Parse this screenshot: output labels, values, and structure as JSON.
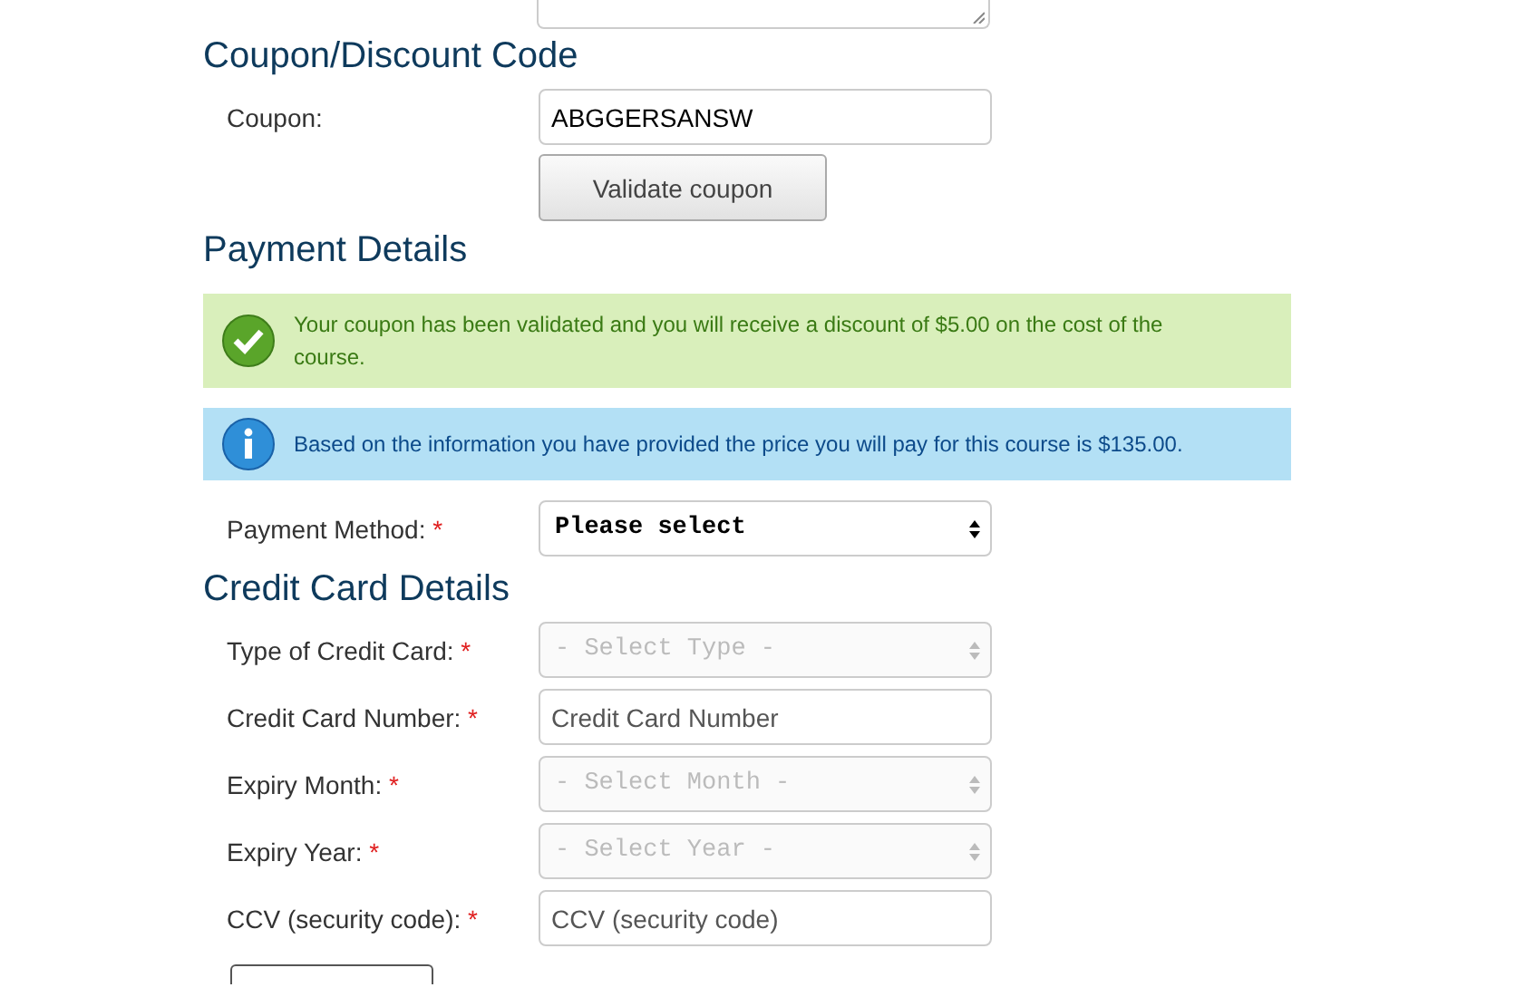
{
  "sections": [
    {
      "heading": "Coupon/Discount Code",
      "fields": [
        {
          "label": "Coupon:",
          "kind": "text",
          "value": "ABGGERSANSW"
        }
      ],
      "button": "Validate coupon"
    },
    {
      "heading": "Payment Details",
      "alerts": [
        {
          "kind": "success",
          "text": "Your coupon has been validated and you will receive a discount of $5.00 on the cost of the course."
        },
        {
          "kind": "info",
          "text": "Based on the information you have provided the price you will pay for this course is $135.00."
        }
      ],
      "fields": [
        {
          "label": "Payment Method:",
          "required_mark": "*",
          "kind": "select",
          "value": "Please select",
          "disabled": false
        }
      ]
    },
    {
      "heading": "Credit Card Details",
      "fields": [
        {
          "label": "Type of Credit Card:",
          "required_mark": "*",
          "kind": "select",
          "value": "- Select Type -",
          "disabled": true
        },
        {
          "label": "Credit Card Number:",
          "required_mark": "*",
          "kind": "text",
          "placeholder": "Credit Card Number"
        },
        {
          "label": "Expiry Month:",
          "required_mark": "*",
          "kind": "select",
          "value": "- Select Month -",
          "disabled": true
        },
        {
          "label": "Expiry Year:",
          "required_mark": "*",
          "kind": "select",
          "value": "- Select Year -",
          "disabled": true
        },
        {
          "label": "CCV (security code):",
          "required_mark": "*",
          "kind": "text",
          "placeholder": "CCV (security code)"
        }
      ]
    }
  ]
}
